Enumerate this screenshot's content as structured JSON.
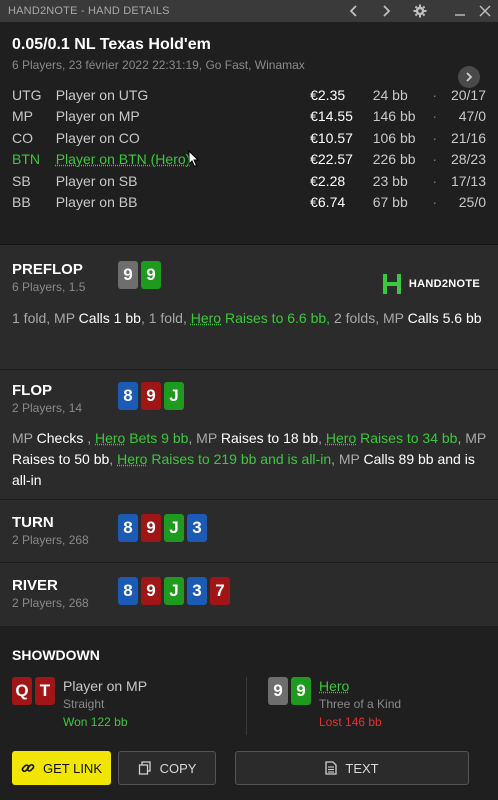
{
  "window": {
    "title": "HAND2NOTE - HAND DETAILS"
  },
  "header": {
    "game_title": "0.05/0.1 NL Texas Hold'em",
    "subtitle": "6 Players, 23 février 2022 22:31:19, Go Fast, Winamax"
  },
  "players": [
    {
      "pos": "UTG",
      "name": "Player on UTG",
      "stack": "€2.35",
      "bb": "24 bb",
      "ratio": "20/17"
    },
    {
      "pos": "MP",
      "name": "Player on MP",
      "stack": "€14.55",
      "bb": "146 bb",
      "ratio": "47/0"
    },
    {
      "pos": "CO",
      "name": "Player on CO",
      "stack": "€10.57",
      "bb": "106 bb",
      "ratio": "21/16"
    },
    {
      "pos": "BTN",
      "name": "Player on BTN (Hero)",
      "stack": "€22.57",
      "bb": "226 bb",
      "ratio": "28/23"
    },
    {
      "pos": "SB",
      "name": "Player on SB",
      "stack": "€2.28",
      "bb": "23 bb",
      "ratio": "17/13"
    },
    {
      "pos": "BB",
      "name": "Player on BB",
      "stack": "€6.74",
      "bb": "67 bb",
      "ratio": "25/0"
    }
  ],
  "logo": {
    "text": "HAND2NOTE"
  },
  "streets": {
    "preflop": {
      "name": "PREFLOP",
      "sub": "6 Players, 1.5",
      "cards": [
        "9",
        "9"
      ],
      "actions": {
        "a1": "1 fold, MP ",
        "a2": "Calls 1 bb",
        "a3": ", 1 fold, ",
        "a4": "Hero",
        "a5": " Raises to 6.6 bb,",
        "a6": " 2 folds, MP ",
        "a7": "Calls 5.6 bb"
      }
    },
    "flop": {
      "name": "FLOP",
      "sub": "2 Players, 14",
      "cards": [
        "8",
        "9",
        "J"
      ],
      "actions": {
        "a1": "MP ",
        "a2": "Checks",
        "a3": " , ",
        "a4": "Hero",
        "a5": " Bets 9 bb",
        "a6": ", MP ",
        "a7": "Raises to 18 bb",
        "a8": ", ",
        "a9": "Hero",
        "a10": " Raises to 34 bb",
        "a11": ", MP ",
        "a12": "Raises to 50 bb",
        "a13": ", ",
        "a14": "Hero",
        "a15": " Raises to 219 bb and is all-in",
        "a16": ", MP ",
        "a17": "Calls 89 bb and is all-in"
      }
    },
    "turn": {
      "name": "TURN",
      "sub": "2 Players, 268",
      "cards": [
        "8",
        "9",
        "J",
        "3"
      ]
    },
    "river": {
      "name": "RIVER",
      "sub": "2 Players, 268",
      "cards": [
        "8",
        "9",
        "J",
        "3",
        "7"
      ]
    }
  },
  "showdown": {
    "title": "SHOWDOWN",
    "villain": {
      "cards": [
        "Q",
        "T"
      ],
      "name": "Player on MP",
      "hand": "Straight",
      "result": "Won 122 bb"
    },
    "hero": {
      "cards": [
        "9",
        "9"
      ],
      "name": "Hero",
      "hand": "Three of a Kind",
      "result": "Lost 146 bb"
    }
  },
  "buttons": {
    "get_link": "GET LINK",
    "copy": "COPY",
    "text": "TEXT"
  },
  "colors": {
    "hero_green": "#3cc83c",
    "lost_red": "#e23232",
    "link_yellow": "#f2e600",
    "card_blue": "#1c5bb5",
    "card_red": "#a01616",
    "card_green": "#1e9a1e",
    "card_grey": "#6e6e6e"
  },
  "icons": [
    "chevron-left-icon",
    "chevron-right-icon",
    "gear-icon",
    "minimize-icon",
    "close-icon",
    "chevron-right-circle-icon",
    "link-icon",
    "copy-icon",
    "document-icon"
  ]
}
